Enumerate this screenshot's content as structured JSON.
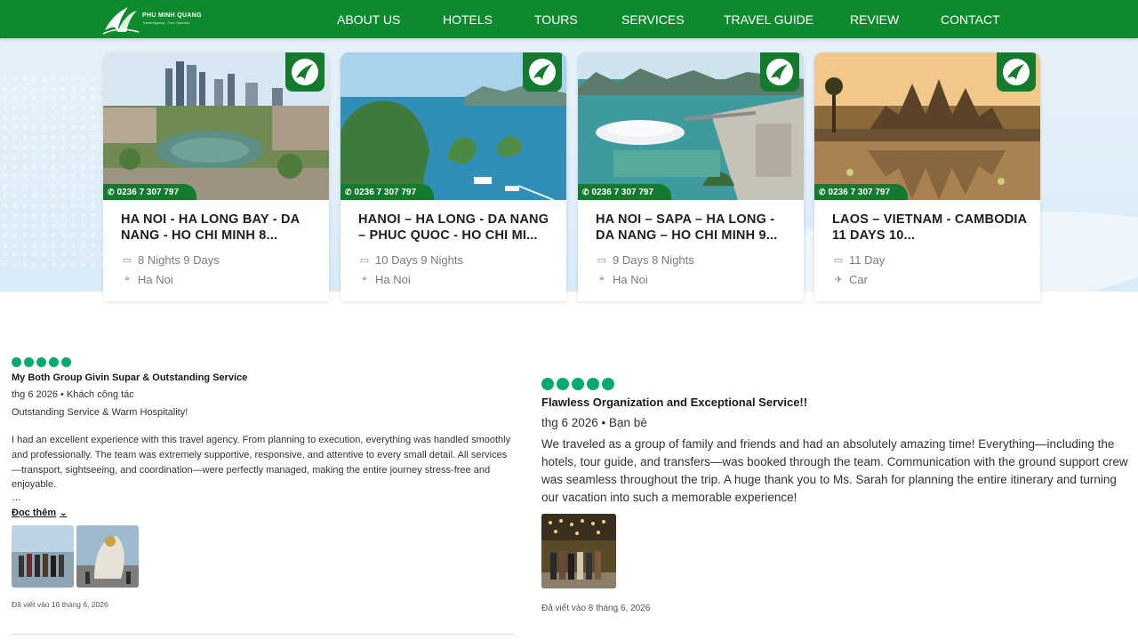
{
  "header": {
    "brand": "PHU MINH QUANG",
    "tagline": "Travel Agency - Tour Operator",
    "nav": [
      "ABOUT US",
      "HOTELS",
      "TOURS",
      "SERVICES",
      "TRAVEL GUIDE",
      "REVIEW",
      "CONTACT"
    ],
    "color": "#0e8a2e"
  },
  "tours": [
    {
      "title": "HA NOI - HA LONG BAY - DA NANG - HO CHI MINH 8...",
      "duration": "8 Nights 9 Days",
      "detail": "Ha Noi",
      "detail_icon": "location-pin-icon",
      "phone": "0236 7 307 797"
    },
    {
      "title": "HANOI – HA LONG - DA NANG – PHUC QUOC - HO CHI MI...",
      "duration": "10 Days 9 Nights",
      "detail": "Ha Noi",
      "detail_icon": "location-pin-icon",
      "phone": "0236 7 307 797"
    },
    {
      "title": "HA NOI – SAPA – HA LONG - DA NANG – HO CHI MINH 9...",
      "duration": "9 Days 8 Nights",
      "detail": "Ha Noi",
      "detail_icon": "location-pin-icon",
      "phone": "0236 7 307 797"
    },
    {
      "title": "LAOS – VIETNAM - CAMBODIA 11 DAYS 10...",
      "duration": "11 Day",
      "detail": "Car",
      "detail_icon": "plane-icon",
      "phone": "0236 7 307 797"
    }
  ],
  "reviews": [
    {
      "rating": 5,
      "title": "My Both Group Givin Supar & Outstanding Service",
      "meta": "thg 6 2026 • Khách công tác",
      "subtitle": "Outstanding Service & Warm Hospitality!",
      "body": "I had an excellent experience with this travel agency. From planning to execution, everything was handled smoothly and professionally. The team was extremely supportive, responsive, and attentive to every small detail. All services—transport, sightseeing, and coordination—were perfectly managed, making the entire journey stress-free and enjoyable.",
      "ellipsis": "…",
      "read_more": "Đọc thêm",
      "written": "Đã viết vào 16 tháng 6, 2026",
      "star_color": "#00aa6c"
    },
    {
      "rating": 5,
      "title": "Flawless Organization and Exceptional Service!!",
      "meta": "thg 6 2026 • Bạn bè",
      "body": "We traveled as a group of family and friends and had an absolutely amazing time! Everything—including the hotels, tour guide, and transfers—was booked through the team. Communication with the ground support crew was seamless throughout the trip. A huge thank you to Ms. Sarah for planning the entire itinerary and turning our vacation into such a memorable experience!",
      "written": "Đã viết vào 8 tháng 6, 2026",
      "star_color": "#00aa6c"
    }
  ]
}
